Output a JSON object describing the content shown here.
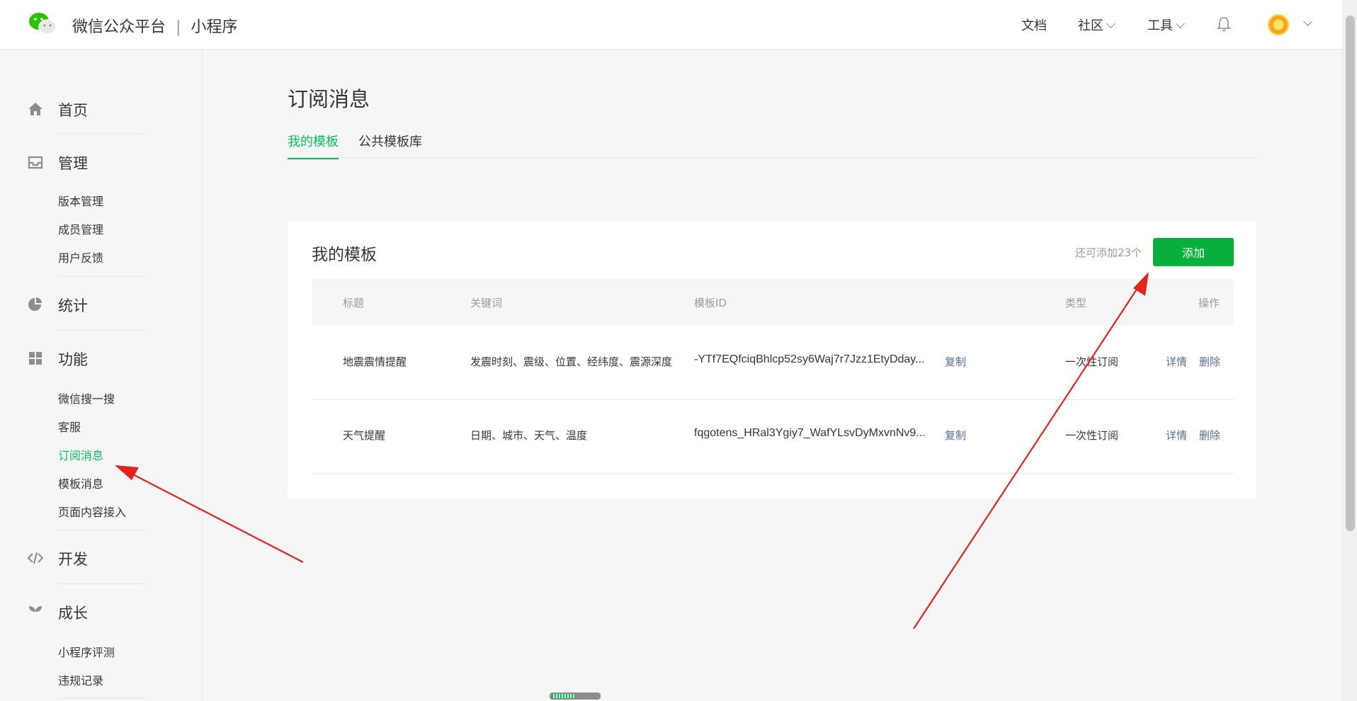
{
  "header": {
    "platform": "微信公众平台",
    "separator": "|",
    "product": "小程序",
    "nav": {
      "docs": "文档",
      "community": "社区",
      "tools": "工具"
    }
  },
  "sidebar": {
    "home": "首页",
    "manage": "管理",
    "manage_items": [
      "版本管理",
      "成员管理",
      "用户反馈"
    ],
    "stats": "统计",
    "features": "功能",
    "feature_items": [
      "微信搜一搜",
      "客服",
      "订阅消息",
      "模板消息",
      "页面内容接入"
    ],
    "dev": "开发",
    "growth": "成长",
    "growth_items": [
      "小程序评测",
      "违规记录"
    ]
  },
  "main": {
    "title": "订阅消息",
    "tabs": [
      "我的模板",
      "公共模板库"
    ],
    "card_title": "我的模板",
    "remaining": "还可添加23个",
    "add_label": "添加",
    "columns": [
      "标题",
      "关键词",
      "模板ID",
      "类型",
      "操作"
    ],
    "rows": [
      {
        "title": "地震震情提醒",
        "keywords": "发震时刻、震级、位置、经纬度、震源深度",
        "template_id": "-YTf7EQfciqBhlcp52sy6Waj7r7Jzz1EtyDday...",
        "copy": "复制",
        "type": "一次性订阅",
        "detail": "详情",
        "delete": "删除"
      },
      {
        "title": "天气提醒",
        "keywords": "日期、城市、天气、温度",
        "template_id": "fqgotens_HRal3Ygiy7_WafYLsvDyMxvnNv9...",
        "copy": "复制",
        "type": "一次性订阅",
        "detail": "详情",
        "delete": "删除"
      }
    ]
  },
  "colors": {
    "accent": "#07c160",
    "button": "#07b03a",
    "link": "#576b95",
    "annotation_arrow": "#e8231b"
  },
  "icons": [
    "wechat-logo-icon",
    "bell-icon",
    "home-icon",
    "inbox-icon",
    "pie-chart-icon",
    "grid-icon",
    "code-icon",
    "sprout-icon"
  ]
}
